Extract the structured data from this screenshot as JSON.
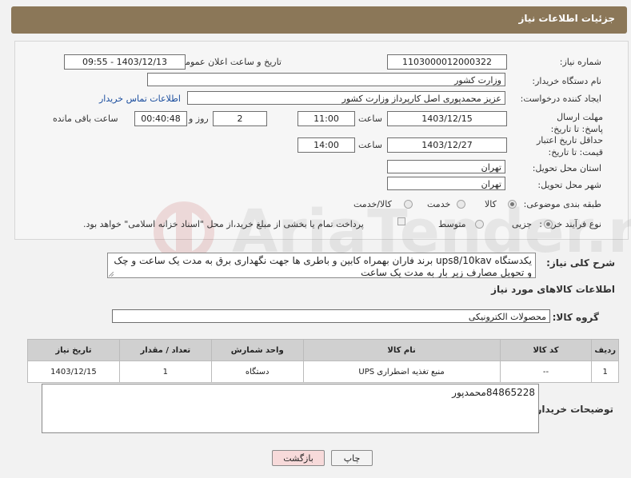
{
  "header": {
    "title": "جزئیات اطلاعات نیاز"
  },
  "form": {
    "need_number": {
      "label": "شماره نیاز:",
      "value": "1103000012000322"
    },
    "announce_datetime": {
      "label": "تاریخ و ساعت اعلان عمومی:",
      "value": "1403/12/13 - 09:55"
    },
    "buyer_org": {
      "label": "نام دستگاه خریدار:",
      "value": "وزارت کشور"
    },
    "requester": {
      "label": "ایجاد کننده درخواست:",
      "value": "عزیز محمدپوری اصل کارپرداز وزارت کشور",
      "contact_link": "اطلاعات تماس خریدار"
    },
    "reply_deadline": {
      "label": "مهلت ارسال پاسخ: تا تاریخ:",
      "date": "1403/12/15",
      "time_label": "ساعت",
      "time": "11:00",
      "days": "2",
      "days_label": "روز و",
      "remaining": "00:40:48",
      "remaining_label": "ساعت باقی مانده"
    },
    "price_validity": {
      "label": "حداقل تاریخ اعتبار قیمت: تا تاریخ:",
      "date": "1403/12/27",
      "time_label": "ساعت",
      "time": "14:00"
    },
    "province": {
      "label": "استان محل تحویل:",
      "value": "تهران"
    },
    "city": {
      "label": "شهر محل تحویل:",
      "value": "تهران"
    },
    "category": {
      "label": "طبقه بندی موضوعی:",
      "options": [
        "کالا",
        "خدمت",
        "کالا/خدمت"
      ],
      "selected": "کالا"
    },
    "purchase_type": {
      "label": "نوع فرآیند خرید :",
      "options": [
        "جزیی",
        "متوسط"
      ],
      "selected": "جزیی",
      "note": "پرداخت تمام یا بخشی از مبلغ خرید،از محل \"اسناد خزانه اسلامی\" خواهد بود."
    }
  },
  "description": {
    "label": "شرح کلی نیاز:",
    "text": "یکدستگاه ups8/10kav برند فاران بهمراه کابین و باطری ها جهت نگهداری برق به مدت یک ساعت و چک و تحویل مصارف زیر بار به مدت یک ساعت"
  },
  "goods": {
    "section_title": "اطلاعات کالاهای مورد نیاز",
    "group_label": "گروه کالا:",
    "group_value": "محصولات الکترونیکی",
    "table": {
      "headers": [
        "ردیف",
        "کد کالا",
        "نام کالا",
        "واحد شمارش",
        "تعداد / مقدار",
        "تاریخ نیاز"
      ],
      "rows": [
        [
          "1",
          "--",
          "منبع تغذیه اضطراری UPS",
          "دستگاه",
          "1",
          "1403/12/15"
        ]
      ]
    }
  },
  "buyer_notes": {
    "label": "توضیحات خریدار:",
    "text": "84865228محمدپور"
  },
  "buttons": {
    "print": "چاپ",
    "back": "بازگشت"
  },
  "watermark": {
    "text": "AriaTender.neT"
  },
  "colors": {
    "header_bg": "#8b7758",
    "back_button_bg": "#f7dada",
    "link": "#1a4d9e"
  }
}
